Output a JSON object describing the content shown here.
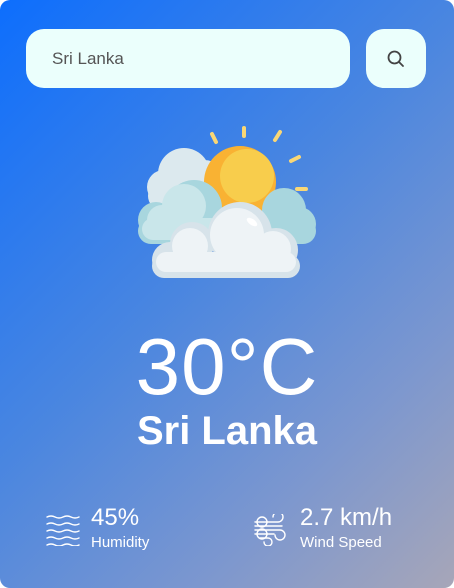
{
  "search": {
    "value": "Sri Lanka",
    "button_icon": "search-icon"
  },
  "weather": {
    "icon": "sun-behind-clouds-icon",
    "temperature": "30°C",
    "city": "Sri Lanka"
  },
  "details": {
    "humidity": {
      "value": "45%",
      "label": "Humidity",
      "icon": "humidity-waves-icon"
    },
    "wind": {
      "value": "2.7 km/h",
      "label": "Wind Speed",
      "icon": "wind-icon"
    }
  },
  "colors": {
    "gradient_start": "#0d6efd",
    "gradient_end": "#a7a6b8",
    "input_background": "#ebfffc",
    "text": "#ffffff"
  }
}
